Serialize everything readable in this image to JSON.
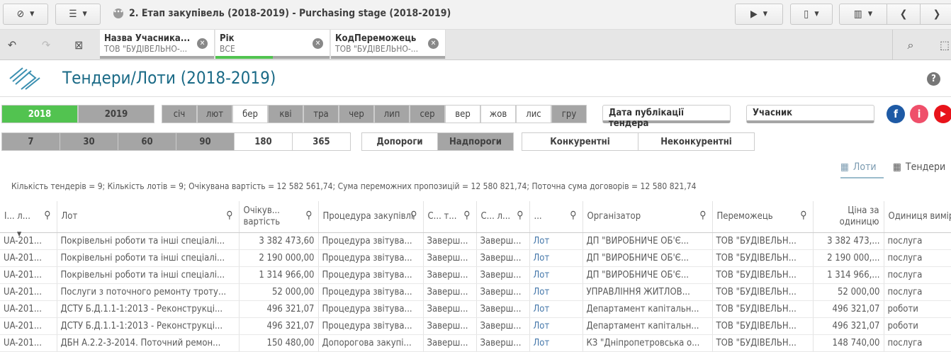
{
  "topbar": {
    "title": "2. Етап закупівель (2018-2019) - Purchasing stage (2018-2019)"
  },
  "selections": [
    {
      "field": "Назва Учасника...",
      "value": "ТОВ \"БУДІВЕЛЬНО-...",
      "progress": 0
    },
    {
      "field": "Рік",
      "value": "ВСЕ",
      "progress": 0.5
    },
    {
      "field": "КодПереможець",
      "value": "ТОВ \"БУДІВЕЛЬНО-...",
      "progress": 0
    }
  ],
  "sheet": {
    "title": "Тендери/Лоти (2018-2019)"
  },
  "years": [
    {
      "label": "2018",
      "selected": true
    },
    {
      "label": "2019",
      "selected": false
    }
  ],
  "months": [
    {
      "label": "січ",
      "grey": true
    },
    {
      "label": "лют",
      "grey": true
    },
    {
      "label": "бер",
      "grey": false
    },
    {
      "label": "кві",
      "grey": true
    },
    {
      "label": "тра",
      "grey": true
    },
    {
      "label": "чер",
      "grey": true
    },
    {
      "label": "лип",
      "grey": true
    },
    {
      "label": "сер",
      "grey": true
    },
    {
      "label": "вер",
      "grey": false
    },
    {
      "label": "жов",
      "grey": false
    },
    {
      "label": "лис",
      "grey": false
    },
    {
      "label": "гру",
      "grey": true
    }
  ],
  "days": [
    {
      "label": "7",
      "grey": true
    },
    {
      "label": "30",
      "grey": true
    },
    {
      "label": "60",
      "grey": true
    },
    {
      "label": "90",
      "grey": true
    },
    {
      "label": "180",
      "grey": false
    },
    {
      "label": "365",
      "grey": false
    }
  ],
  "thresholds": [
    {
      "label": "Допороги",
      "grey": false
    },
    {
      "label": "Надпороги",
      "grey": true
    }
  ],
  "competition": [
    {
      "label": "Конкурентні"
    },
    {
      "label": "Неконкурентні"
    }
  ],
  "filters": {
    "date": "Дата публікації тендера",
    "participant": "Учасник"
  },
  "view_tabs": {
    "lots": "Лоти",
    "tenders": "Тендери"
  },
  "kpi": "Кількість тендерів = 9; Кількість лотів = 9; Очікувана вартість = 12 582 561,74; Сума переможних пропозицій = 12 580 821,74; Поточна сума договорів = 12 580 821,74",
  "table": {
    "headers": [
      "I... л...",
      "Лот",
      "Очікув... вартість",
      "Процедура закупівлі",
      "С... т...",
      "С... л...",
      "...",
      "Організатор",
      "Переможець",
      "Ціна за одиницю",
      "Одиниця виміру"
    ],
    "rows": [
      [
        "UA-201...",
        "Покрівельні роботи та інші спеціалі...",
        "3 382 473,60",
        "Процедура звітува...",
        "Заверш...",
        "Заверш...",
        "Лот",
        "ДП \"ВИРОБНИЧЕ ОБ'Є...",
        "ТОВ \"БУДІВЕЛЬН...",
        "3 382 473,...",
        "послуга"
      ],
      [
        "UA-201...",
        "Покрівельні роботи та інші спеціалі...",
        "2 190 000,00",
        "Процедура звітува...",
        "Заверш...",
        "Заверш...",
        "Лот",
        "ДП \"ВИРОБНИЧЕ ОБ'Є...",
        "ТОВ \"БУДІВЕЛЬН...",
        "2 190 000,...",
        "послуга"
      ],
      [
        "UA-201...",
        "Покрівельні роботи та інші спеціалі...",
        "1 314 966,00",
        "Процедура звітува...",
        "Заверш...",
        "Заверш...",
        "Лот",
        "ДП \"ВИРОБНИЧЕ ОБ'Є...",
        "ТОВ \"БУДІВЕЛЬН...",
        "1 314 966,...",
        "послуга"
      ],
      [
        "UA-201...",
        "Послуги з поточного ремонту троту...",
        "52 000,00",
        "Процедура звітува...",
        "Заверш...",
        "Заверш...",
        "Лот",
        "УПРАВЛІННЯ ЖИТЛОВ...",
        "ТОВ \"БУДІВЕЛЬН...",
        "52 000,00",
        "послуга"
      ],
      [
        "UA-201...",
        "ДСТУ Б.Д.1.1-1:2013 - Реконструкці...",
        "496 321,07",
        "Процедура звітува...",
        "Заверш...",
        "Заверш...",
        "Лот",
        "Департамент капітальн...",
        "ТОВ \"БУДІВЕЛЬН...",
        "496 321,07",
        "роботи"
      ],
      [
        "UA-201...",
        "ДСТУ Б.Д.1.1-1:2013 - Реконструкці...",
        "496 321,07",
        "Процедура звітува...",
        "Заверш...",
        "Заверш...",
        "Лот",
        "Департамент капітальн...",
        "ТОВ \"БУДІВЕЛЬН...",
        "496 321,07",
        "роботи"
      ],
      [
        "UA-201...",
        "ДБН А.2.2-3-2014. Поточний ремон...",
        "150 480,00",
        "Допорогова закупі...",
        "Заверш...",
        "Заверш...",
        "Лот",
        "КЗ \"Дніпропетровська о...",
        "ТОВ \"БУДІВЕЛЬН...",
        "148 740,00",
        "послуга"
      ]
    ]
  },
  "colors": {
    "accent": "#52c350",
    "title": "#1a6a86",
    "link": "#4477aa",
    "excluded": "#a5a5a5"
  }
}
